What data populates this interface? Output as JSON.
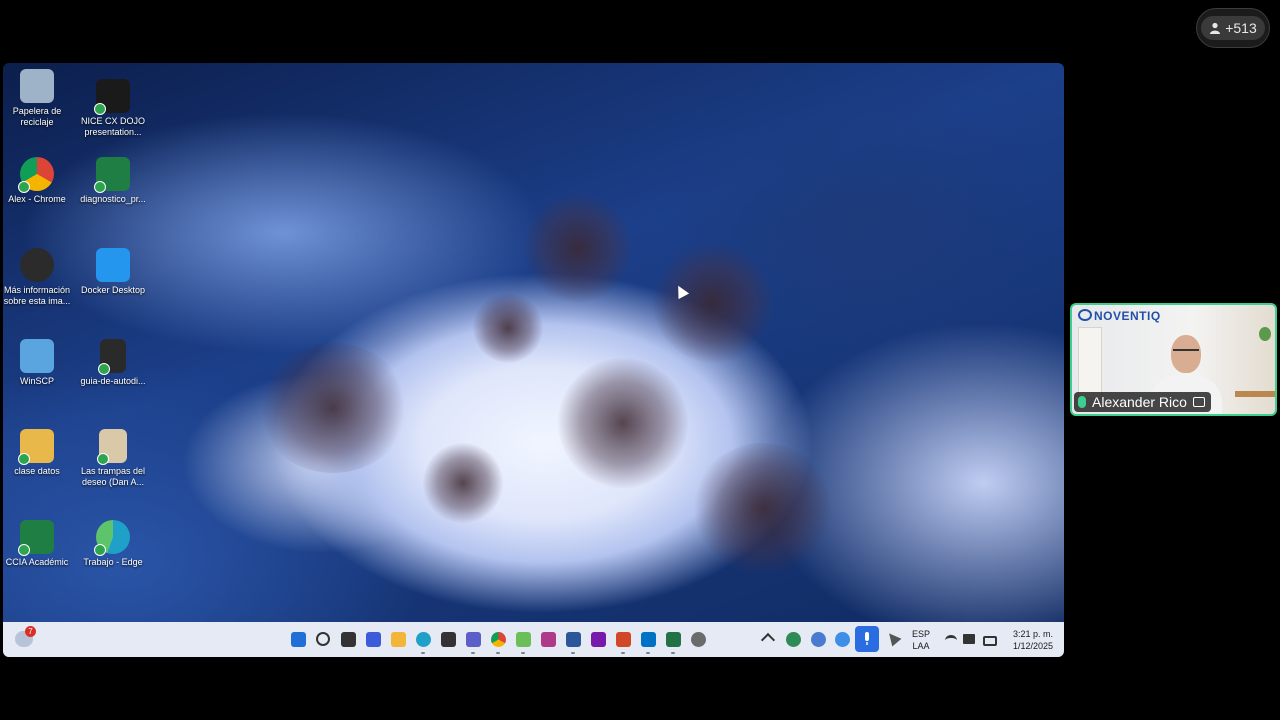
{
  "meeting": {
    "participants_count": "+513",
    "presenter_name": "Alexander Rico",
    "presenter_brand": "NOVENTIQ"
  },
  "desktop_icons": [
    {
      "id": "recycle",
      "label": "Papelera de\nreciclaje",
      "color": "#9fb3c8"
    },
    {
      "id": "nice",
      "label": "NICE CX DOJO\npresentation...",
      "color": "#1a1a1a"
    },
    {
      "id": "chrome",
      "label": "Alex - Chrome",
      "color": "#db4437"
    },
    {
      "id": "diag",
      "label": "diagnostico_pr...",
      "color": "#1e7e44"
    },
    {
      "id": "info",
      "label": "Más información\nsobre esta ima...",
      "color": "#2b2b2b"
    },
    {
      "id": "docker",
      "label": "Docker Desktop",
      "color": "#2496ed"
    },
    {
      "id": "winscp",
      "label": "WinSCP",
      "color": "#5aa5e0"
    },
    {
      "id": "guia",
      "label": "guia-de-autodi...",
      "color": "#2a2a2a"
    },
    {
      "id": "clase",
      "label": "clase datos",
      "color": "#e8b84a"
    },
    {
      "id": "trampas",
      "label": "Las trampas del\ndeseo (Dan A...",
      "color": "#d9c9a8"
    },
    {
      "id": "ccia",
      "label": "CCIA Académic",
      "color": "#1e7e44"
    },
    {
      "id": "edge",
      "label": "Trabajo - Edge",
      "color": "#1fa0c9"
    }
  ],
  "taskbar": {
    "weather_badge": "7",
    "language_line1": "ESP",
    "language_line2": "LAA",
    "time": "3:21 p. m.",
    "date": "1/12/2025",
    "apps": [
      {
        "name": "start-icon",
        "color": "#1f6fd6"
      },
      {
        "name": "search-icon",
        "color": "#333333"
      },
      {
        "name": "task-view-icon",
        "color": "#333333"
      },
      {
        "name": "store-icon",
        "color": "#3b5bdb"
      },
      {
        "name": "file-explorer-icon",
        "color": "#f2b53a"
      },
      {
        "name": "edge-icon",
        "color": "#1fa0c9"
      },
      {
        "name": "calculator-icon",
        "color": "#333333"
      },
      {
        "name": "teams-icon",
        "color": "#5b5fc7"
      },
      {
        "name": "chrome-icon",
        "color": "#db4437"
      },
      {
        "name": "notepad-icon",
        "color": "#6bbf59"
      },
      {
        "name": "winrar-icon",
        "color": "#b03a8a"
      },
      {
        "name": "word-icon",
        "color": "#2b579a"
      },
      {
        "name": "onenote-icon",
        "color": "#7719aa"
      },
      {
        "name": "powerpoint-icon",
        "color": "#d24726"
      },
      {
        "name": "outlook-icon",
        "color": "#0072c6"
      },
      {
        "name": "excel-icon",
        "color": "#217346"
      },
      {
        "name": "settings-icon",
        "color": "#6b6b6b"
      }
    ]
  }
}
